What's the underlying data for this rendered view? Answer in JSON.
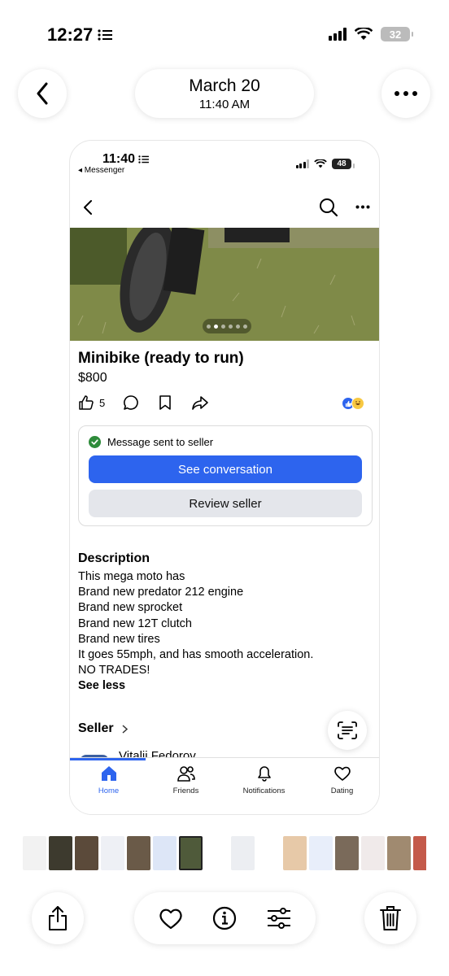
{
  "status_bar": {
    "time": "12:27",
    "battery": "32"
  },
  "header": {
    "date": "March 20",
    "time": "11:40 AM"
  },
  "screenshot": {
    "status_bar": {
      "time": "11:40",
      "back_app": "◂ Messenger",
      "battery": "48"
    },
    "listing": {
      "title": "Minibike (ready to run)",
      "price": "$800",
      "like_count": "5",
      "message_status": "Message sent to seller",
      "see_conversation_label": "See conversation",
      "review_seller_label": "Review seller",
      "description_heading": "Description",
      "description_lines": [
        "This mega moto has",
        "Brand new predator 212 engine",
        "Brand new sprocket",
        "Brand new 12T clutch",
        "Brand new tires",
        "It goes 55mph, and has smooth acceleration.",
        "NO TRADES!"
      ],
      "see_less_label": "See less",
      "seller_heading": "Seller",
      "seller_name": "Vitalii Fedorov"
    },
    "tabs": [
      {
        "label": "Home",
        "icon": "home-icon",
        "active": true
      },
      {
        "label": "Friends",
        "icon": "friends-icon"
      },
      {
        "label": "Notifications",
        "icon": "bell-icon"
      },
      {
        "label": "Dating",
        "icon": "heart-icon"
      }
    ]
  },
  "colors": {
    "accent": "#2d64ee",
    "secondary_button": "#e4e6eb",
    "success": "#2e8b3a"
  }
}
